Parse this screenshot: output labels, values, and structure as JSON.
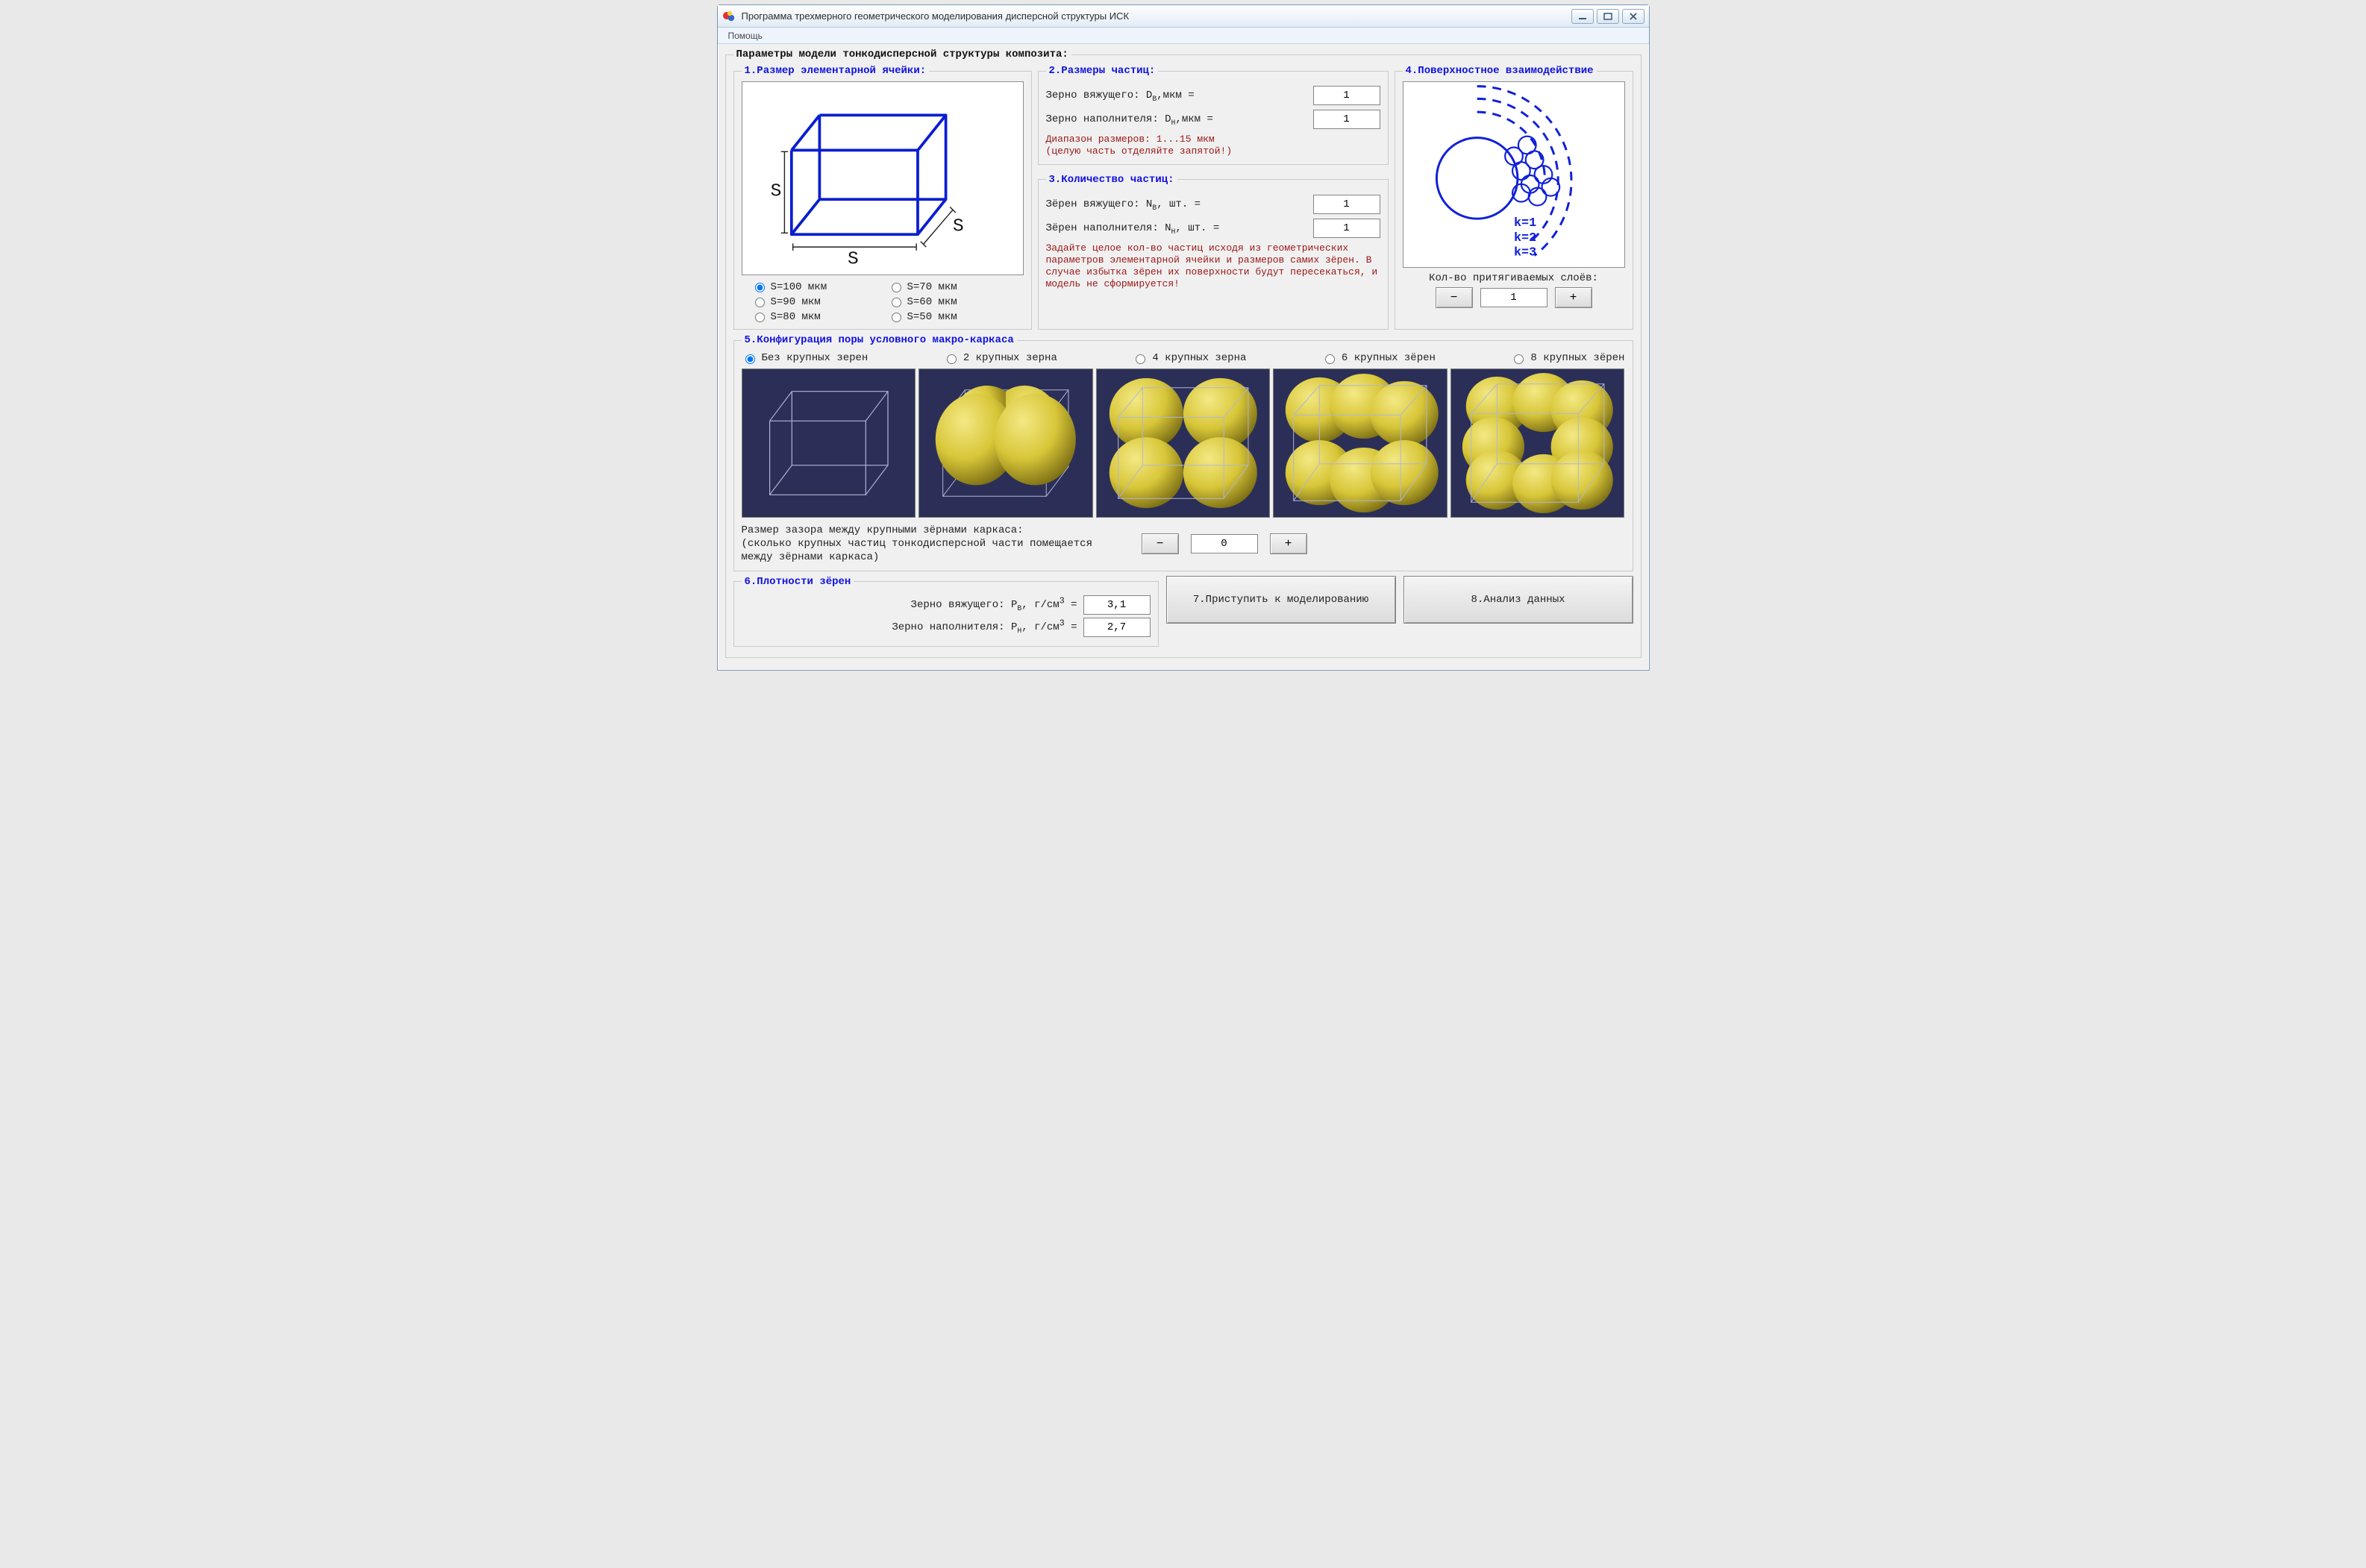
{
  "window": {
    "title": "Программа трехмерного геометрического моделирования дисперсной структуры ИСК"
  },
  "menu": {
    "help": "Помощь"
  },
  "mainLegend": "Параметры модели тонкодисперсной структуры композита:",
  "box1": {
    "legend": "1.Размер элементарной ячейки:",
    "opts": [
      "S=100 мкм",
      "S=70 мкм",
      "S=90 мкм",
      "S=60 мкм",
      "S=80 мкм",
      "S=50 мкм"
    ]
  },
  "box2": {
    "legend": "2.Размеры частиц:",
    "binderLabelPre": "Зерно вяжущего: D",
    "binderLabelSub": "B",
    "unitSuffix": ",мкм =",
    "fillerLabelPre": "Зерно наполнителя: D",
    "fillerLabelSub": "H",
    "binderVal": "1",
    "fillerVal": "1",
    "note": "Диапазон размеров: 1...15 мкм\n(целую часть отделяйте запятой!)"
  },
  "box3": {
    "legend": "3.Количество частиц:",
    "binderLabelPre": "Зёрен вяжущего: N",
    "binderLabelSub": "B",
    "fillerLabelPre": "Зёрен наполнителя: N",
    "fillerLabelSub": "H",
    "unitSuffix": ", шт. =",
    "binderVal": "1",
    "fillerVal": "1",
    "note": "Задайте целое кол-во частиц исходя из геометрических параметров элементарной ячейки и размеров самих зёрен. В случае избытка зёрен их поверхности будут пересекаться, и модель не сформируется!"
  },
  "box4": {
    "legend": "4.Поверхностное взаимодействие",
    "k1": "k=1",
    "k2": "k=2",
    "k3": "k=3",
    "countLabel": "Кол-во притягиваемых слоёв:",
    "val": "1",
    "minus": "−",
    "plus": "+"
  },
  "box5": {
    "legend": "5.Конфигурация поры условного макро-каркаса",
    "opts": [
      "Без крупных зерен",
      "2 крупных зерна",
      "4 крупных зерна",
      "6 крупных зёрен",
      "8 крупных зёрен"
    ],
    "gapText": "Размер зазора между крупными зёрнами каркаса:\n(сколько крупных частиц тонкодисперсной части помещается между зёрнами каркаса)",
    "gapVal": "0",
    "minus": "−",
    "plus": "+"
  },
  "box6": {
    "legend": "6.Плотности зёрен",
    "binderPre": "Зерно вяжущего: P",
    "binderSub": "B",
    "fillerPre": "Зерно наполнителя: P",
    "fillerSub": "H",
    "unit": ", г/см",
    "unitSup": "3",
    "eq": " =",
    "binderVal": "3,1",
    "fillerVal": "2,7"
  },
  "btn7": "7.Приступить к моделированию",
  "btn8": "8.Анализ данных"
}
